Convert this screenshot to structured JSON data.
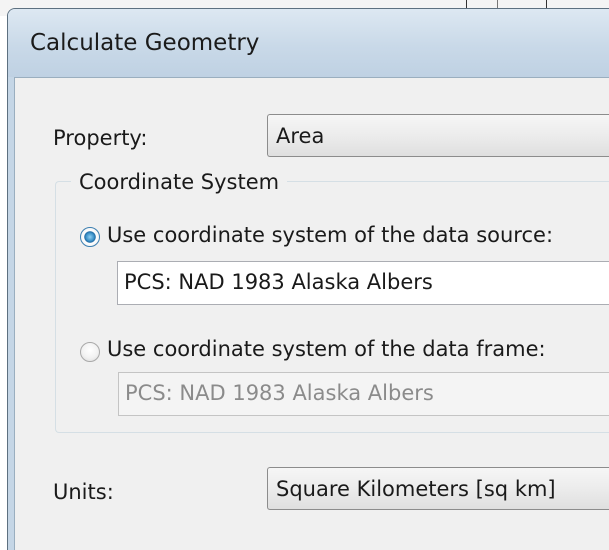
{
  "dialog": {
    "title": "Calculate Geometry"
  },
  "property": {
    "label": "Property:",
    "value": "Area"
  },
  "coordinate_system": {
    "caption": "Coordinate System",
    "data_source": {
      "label": "Use coordinate system of the data source:",
      "value": "PCS: NAD 1983 Alaska Albers",
      "selected": true
    },
    "data_frame": {
      "label": "Use coordinate system of the data frame:",
      "value": "PCS: NAD 1983 Alaska Albers",
      "selected": false
    }
  },
  "units": {
    "label": "Units:",
    "value": "Square Kilometers [sq km]"
  },
  "colors": {
    "titlebar": "#c9d9e8",
    "client_background": "#f0f0f0",
    "radio_selected": "#1f6aa3"
  }
}
